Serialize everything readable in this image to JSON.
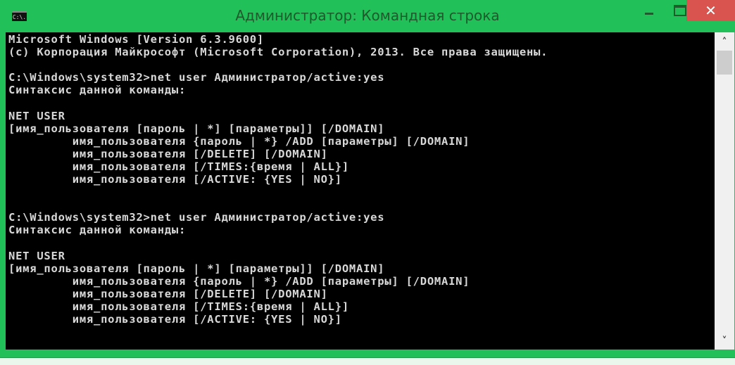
{
  "window": {
    "title": "Администратор: Командная строка",
    "icon_label": "C:\\.",
    "controls": {
      "minimize": "minimize",
      "maximize": "maximize",
      "close": "✕"
    },
    "accent_color": "#22c058",
    "close_color": "#d9534f"
  },
  "console": {
    "lines": [
      "Microsoft Windows [Version 6.3.9600]",
      "(c) Корпорация Майкрософт (Microsoft Corporation), 2013. Все права защищены.",
      "",
      "C:\\Windows\\system32>net user Администратор/active:yes",
      "Синтаксис данной команды:",
      "",
      "NET USER",
      "[имя_пользователя [пароль | *] [параметры]] [/DOMAIN]",
      "         имя_пользователя {пароль | *} /ADD [параметры] [/DOMAIN]",
      "         имя_пользователя [/DELETE] [/DOMAIN]",
      "         имя_пользователя [/TIMES:{время | ALL}]",
      "         имя_пользователя [/ACTIVE: {YES | NO}]",
      "",
      "",
      "C:\\Windows\\system32>net user Администратор/active:yes",
      "Синтаксис данной команды:",
      "",
      "NET USER",
      "[имя_пользователя [пароль | *] [параметры]] [/DOMAIN]",
      "         имя_пользователя {пароль | *} /ADD [параметры] [/DOMAIN]",
      "         имя_пользователя [/DELETE] [/DOMAIN]",
      "         имя_пользователя [/TIMES:{время | ALL}]",
      "         имя_пользователя [/ACTIVE: {YES | NO}]"
    ]
  },
  "scrollbar": {
    "up_icon": "˄",
    "down_icon": "˅",
    "position": 0
  }
}
